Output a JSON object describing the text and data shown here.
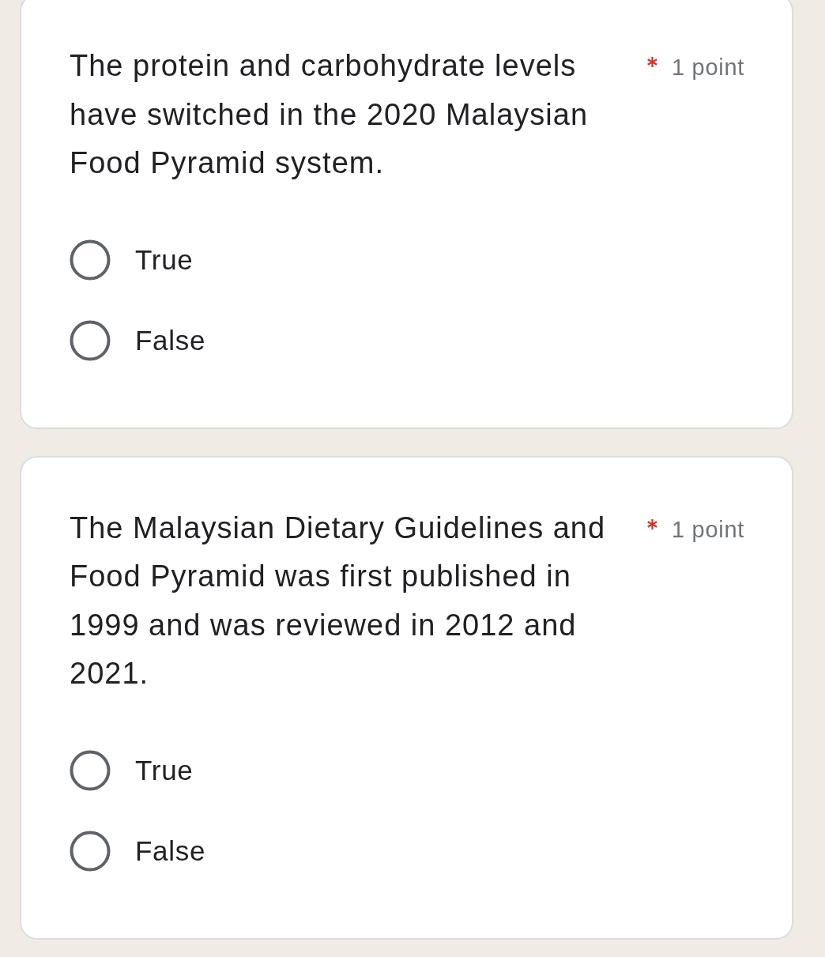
{
  "questions": [
    {
      "text": "The protein and carbohydrate levels have switched in the 2020 Malaysian Food Pyramid system.",
      "required": true,
      "points": "1 point",
      "options": [
        {
          "label": "True",
          "selected": false
        },
        {
          "label": "False",
          "selected": false
        }
      ]
    },
    {
      "text": "The Malaysian Dietary Guidelines and Food Pyramid was first published in 1999 and was reviewed in 2012 and 2021.",
      "required": true,
      "points": "1 point",
      "options": [
        {
          "label": "True",
          "selected": false
        },
        {
          "label": "False",
          "selected": false
        }
      ]
    }
  ]
}
